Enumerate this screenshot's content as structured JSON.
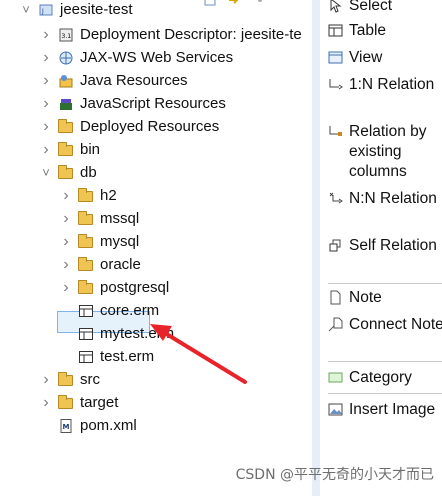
{
  "explorer": {
    "rows": [
      {
        "label": "jeesite-test",
        "icon": "java-project-icon",
        "chevron": "down"
      },
      {
        "label": "Deployment Descriptor: jeesite-te",
        "icon": "deployment-descriptor-icon",
        "chevron": "right"
      },
      {
        "label": "JAX-WS Web Services",
        "icon": "web-services-icon",
        "chevron": "right"
      },
      {
        "label": "Java Resources",
        "icon": "java-resources-icon",
        "chevron": "right"
      },
      {
        "label": "JavaScript Resources",
        "icon": "javascript-resources-icon",
        "chevron": "right"
      },
      {
        "label": "Deployed Resources",
        "icon": "folder-icon",
        "chevron": "right"
      },
      {
        "label": "bin",
        "icon": "folder-icon",
        "chevron": "right"
      },
      {
        "label": "db",
        "icon": "folder-icon",
        "chevron": "down"
      },
      {
        "label": "h2",
        "icon": "folder-icon",
        "chevron": "right"
      },
      {
        "label": "mssql",
        "icon": "folder-icon",
        "chevron": "right"
      },
      {
        "label": "mysql",
        "icon": "folder-icon",
        "chevron": "right"
      },
      {
        "label": "oracle",
        "icon": "folder-icon",
        "chevron": "right"
      },
      {
        "label": "postgresql",
        "icon": "folder-icon",
        "chevron": "right"
      },
      {
        "label": "core.erm",
        "icon": "erm-file-icon",
        "chevron": ""
      },
      {
        "label": "mytest.erm",
        "icon": "erm-file-icon",
        "chevron": ""
      },
      {
        "label": "test.erm",
        "icon": "erm-file-icon",
        "chevron": ""
      },
      {
        "label": "src",
        "icon": "folder-icon",
        "chevron": "right"
      },
      {
        "label": "target",
        "icon": "folder-icon",
        "chevron": "right"
      },
      {
        "label": "pom.xml",
        "icon": "xml-file-icon",
        "chevron": ""
      }
    ]
  },
  "palette": {
    "items": [
      {
        "label": "Select",
        "icon": "select-arrow-icon"
      },
      {
        "label": "Table",
        "icon": "table-icon"
      },
      {
        "label": "View",
        "icon": "view-icon"
      },
      {
        "label": "1:N Relation",
        "icon": "relation-1n-icon"
      },
      {
        "label": "Relation by existing columns",
        "icon": "relation-existing-icon"
      },
      {
        "label": "N:N Relation",
        "icon": "relation-nn-icon"
      },
      {
        "label": "Self Relation",
        "icon": "self-relation-icon"
      },
      {
        "label": "Note",
        "icon": "note-icon"
      },
      {
        "label": "Connect Note",
        "icon": "connect-note-icon"
      },
      {
        "label": "Category",
        "icon": "category-icon"
      },
      {
        "label": "Insert Image",
        "icon": "insert-image-icon"
      }
    ]
  },
  "watermark": "CSDN @平平无奇的小天才而已",
  "colors": {
    "arrow": "#e8242b",
    "selection": "#7eb4ea",
    "folder": "#f0c453"
  }
}
